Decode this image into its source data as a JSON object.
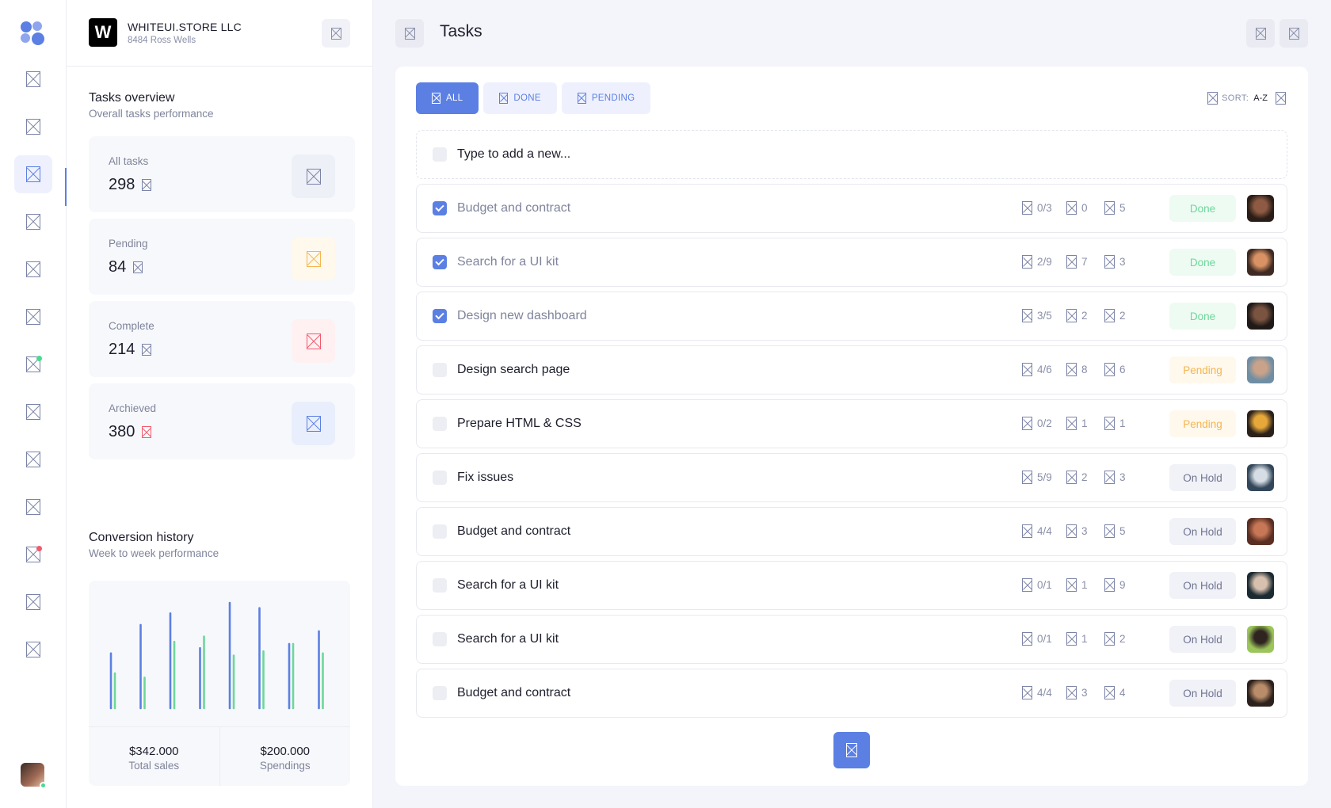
{
  "company": {
    "logo_letter": "W",
    "name": "WHITEUI.STORE LLC",
    "address": "8484 Ross Wells"
  },
  "header": {
    "title": "Tasks"
  },
  "rail": {
    "items": [
      {
        "icon": "nav-icon-1"
      },
      {
        "icon": "nav-icon-2"
      },
      {
        "icon": "tasks-icon",
        "active": true
      },
      {
        "icon": "nav-icon-4"
      },
      {
        "icon": "nav-icon-5"
      },
      {
        "icon": "nav-icon-6"
      },
      {
        "icon": "nav-icon-7",
        "badge": "#4ad991"
      },
      {
        "icon": "nav-icon-8"
      },
      {
        "icon": "nav-icon-9"
      },
      {
        "icon": "nav-icon-10"
      },
      {
        "icon": "nav-icon-11",
        "badge": "#f05a6c"
      },
      {
        "icon": "nav-icon-12"
      },
      {
        "icon": "nav-icon-13"
      }
    ]
  },
  "overview": {
    "title": "Tasks overview",
    "subtitle": "Overall tasks performance",
    "stats": [
      {
        "label": "All tasks",
        "value": "298",
        "color": "#7b83a6",
        "bg": "#eef0f7"
      },
      {
        "label": "Pending",
        "value": "84",
        "color": "#f5b54f",
        "bg": "#fff8ec"
      },
      {
        "label": "Complete",
        "value": "214",
        "color": "#f05a6c",
        "bg": "#fff0f1"
      },
      {
        "label": "Archieved",
        "value": "380",
        "color": "#5b7fe3",
        "bg": "#e9eefc"
      }
    ]
  },
  "conversion": {
    "title": "Conversion history",
    "subtitle": "Week to week performance",
    "total_sales_value": "$342.000",
    "total_sales_label": "Total sales",
    "spendings_value": "$200.000",
    "spendings_label": "Spendings"
  },
  "chart_data": {
    "type": "bar",
    "series": [
      {
        "color": "#5b7fe3",
        "values": [
          0.52,
          0.79,
          0.9,
          0.57,
          1.0,
          0.95,
          0.61,
          0.73
        ]
      },
      {
        "color": "#6dd79a",
        "values": [
          0.33,
          0.29,
          0.63,
          0.68,
          0.5,
          0.54,
          0.61,
          0.52
        ]
      }
    ]
  },
  "tabs": [
    {
      "label": "ALL",
      "active": true
    },
    {
      "label": "DONE",
      "active": false
    },
    {
      "label": "PENDING",
      "active": false
    }
  ],
  "sort": {
    "label": "SORT:",
    "value": "A-Z"
  },
  "new_task": {
    "placeholder": "Type to add a new..."
  },
  "tasks": [
    {
      "title": "Budget and contract",
      "done": true,
      "checklist": "0/3",
      "comments": "0",
      "attachments": "5",
      "status": "Done",
      "status_type": "done",
      "avatar": [
        "#2a1d17",
        "#8e5a43"
      ]
    },
    {
      "title": "Search for a UI kit",
      "done": true,
      "checklist": "2/9",
      "comments": "7",
      "attachments": "3",
      "status": "Done",
      "status_type": "done",
      "avatar": [
        "#3e2a22",
        "#d99264"
      ]
    },
    {
      "title": "Design new dashboard",
      "done": true,
      "checklist": "3/5",
      "comments": "2",
      "attachments": "2",
      "status": "Done",
      "status_type": "done",
      "avatar": [
        "#1f1a18",
        "#7a5440"
      ]
    },
    {
      "title": "Design search page",
      "done": false,
      "checklist": "4/6",
      "comments": "8",
      "attachments": "6",
      "status": "Pending",
      "status_type": "pending",
      "avatar": [
        "#6f8ea3",
        "#c9a28a"
      ]
    },
    {
      "title": "Prepare HTML & CSS",
      "done": false,
      "checklist": "0/2",
      "comments": "1",
      "attachments": "1",
      "status": "Pending",
      "status_type": "pending",
      "avatar": [
        "#2b211b",
        "#e7a83a"
      ]
    },
    {
      "title": "Fix issues",
      "done": false,
      "checklist": "5/9",
      "comments": "2",
      "attachments": "3",
      "status": "On Hold",
      "status_type": "hold",
      "avatar": [
        "#33475a",
        "#d6dde4"
      ]
    },
    {
      "title": "Budget and contract",
      "done": false,
      "checklist": "4/4",
      "comments": "3",
      "attachments": "5",
      "status": "On Hold",
      "status_type": "hold",
      "avatar": [
        "#5a2e22",
        "#c77756"
      ]
    },
    {
      "title": "Search for a UI kit",
      "done": false,
      "checklist": "0/1",
      "comments": "1",
      "attachments": "9",
      "status": "On Hold",
      "status_type": "hold",
      "avatar": [
        "#1c2a31",
        "#d7c0ae"
      ]
    },
    {
      "title": "Search for a UI kit",
      "done": false,
      "checklist": "0/1",
      "comments": "1",
      "attachments": "2",
      "status": "On Hold",
      "status_type": "hold",
      "avatar": [
        "#9bc45a",
        "#2f2420"
      ]
    },
    {
      "title": "Budget and contract",
      "done": false,
      "checklist": "4/4",
      "comments": "3",
      "attachments": "4",
      "status": "On Hold",
      "status_type": "hold",
      "avatar": [
        "#2c211c",
        "#b98c6a"
      ]
    }
  ]
}
